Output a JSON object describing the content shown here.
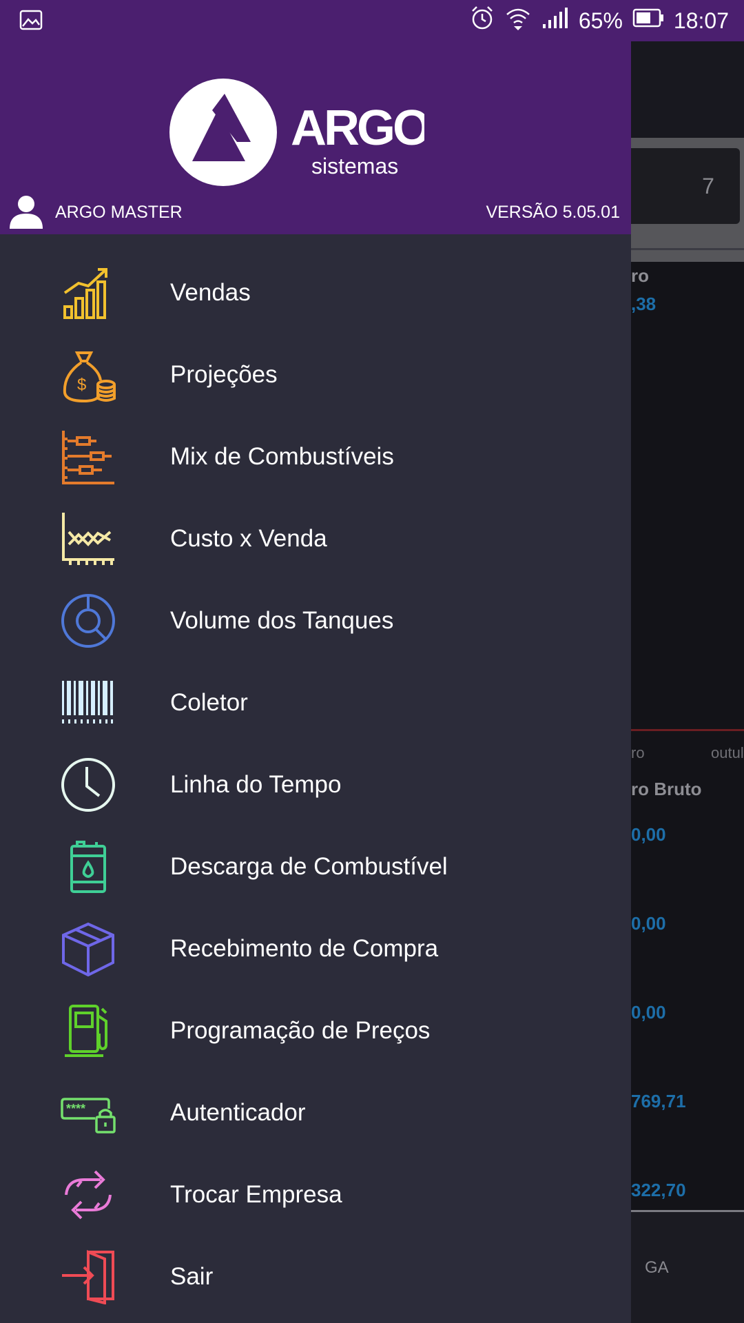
{
  "status_bar": {
    "battery": "65%",
    "time": "18:07"
  },
  "background_app": {
    "calendar_value": "7",
    "partial_label_1": "ro",
    "partial_value_1": ",38",
    "axis_left": "ro",
    "axis_right": "outul",
    "partial_header": "ro Bruto",
    "values": [
      "0,00",
      "0,00",
      "0,00",
      "769,71",
      "322,70"
    ],
    "bottom_tab": "GA"
  },
  "drawer": {
    "brand": "ARGO",
    "brand_sub": "sistemas",
    "user_name": "ARGO MASTER",
    "version": "VERSÃO 5.05.01",
    "menu": [
      {
        "label": "Vendas",
        "icon": "sales-chart-icon",
        "color": "#f2c12e"
      },
      {
        "label": "Projeções",
        "icon": "money-bag-icon",
        "color": "#f29f2b"
      },
      {
        "label": "Mix de Combustíveis",
        "icon": "gantt-chart-icon",
        "color": "#e47b2c"
      },
      {
        "label": "Custo x Venda",
        "icon": "line-chart-icon",
        "color": "#f5e9a6"
      },
      {
        "label": "Volume dos Tanques",
        "icon": "pie-search-icon",
        "color": "#4f78d8"
      },
      {
        "label": "Coletor",
        "icon": "barcode-icon",
        "color": "#d6efff"
      },
      {
        "label": "Linha do Tempo",
        "icon": "clock-icon",
        "color": "#e6f7ef"
      },
      {
        "label": "Descarga de Combustível",
        "icon": "fuel-barrel-icon",
        "color": "#3fcf96"
      },
      {
        "label": "Recebimento de Compra",
        "icon": "package-box-icon",
        "color": "#6f67e8"
      },
      {
        "label": "Programação de Preços",
        "icon": "fuel-pump-icon",
        "color": "#5fd12b"
      },
      {
        "label": "Autenticador",
        "icon": "password-lock-icon",
        "color": "#74e06d"
      },
      {
        "label": "Trocar Empresa",
        "icon": "swap-arrows-icon",
        "color": "#ea7bd8"
      },
      {
        "label": "Sair",
        "icon": "logout-door-icon",
        "color": "#ef4b55"
      }
    ]
  }
}
